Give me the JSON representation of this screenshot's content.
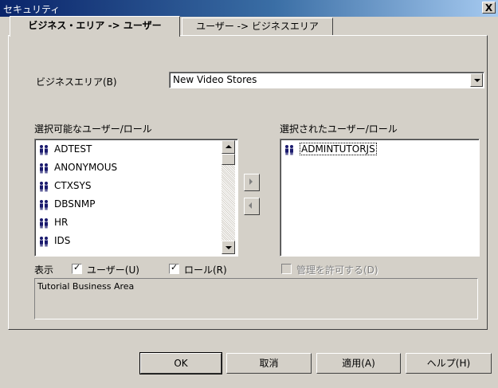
{
  "window": {
    "title": "セキュリティ",
    "close_label": "X"
  },
  "tabs": [
    {
      "label": "ビジネス・エリア -> ユーザー",
      "active": true
    },
    {
      "label": "ユーザー -> ビジネスエリア",
      "active": false
    }
  ],
  "business_area": {
    "label": "ビジネスエリア(B)",
    "value": "New Video Stores"
  },
  "available": {
    "label": "選択可能なユーザー/ロール",
    "items": [
      "ADTEST",
      "ANONYMOUS",
      "CTXSYS",
      "DBSNMP",
      "HR",
      "IDS"
    ]
  },
  "selected": {
    "label": "選択されたユーザー/ロール",
    "items": [
      "ADMINTUTORJS"
    ]
  },
  "display": {
    "label": "表示",
    "users_label": "ユーザー(U)",
    "users_checked": true,
    "roles_label": "ロール(R)",
    "roles_checked": true
  },
  "admin": {
    "label": "管理を許可する(D)",
    "checked": false,
    "disabled": true
  },
  "description": "Tutorial Business Area",
  "buttons": {
    "ok": "OK",
    "cancel": "取消",
    "apply": "適用(A)",
    "help": "ヘルプ(H)"
  },
  "icons": {
    "user": "user-group-icon",
    "move_right": "move-right-icon",
    "move_left": "move-left-icon"
  }
}
